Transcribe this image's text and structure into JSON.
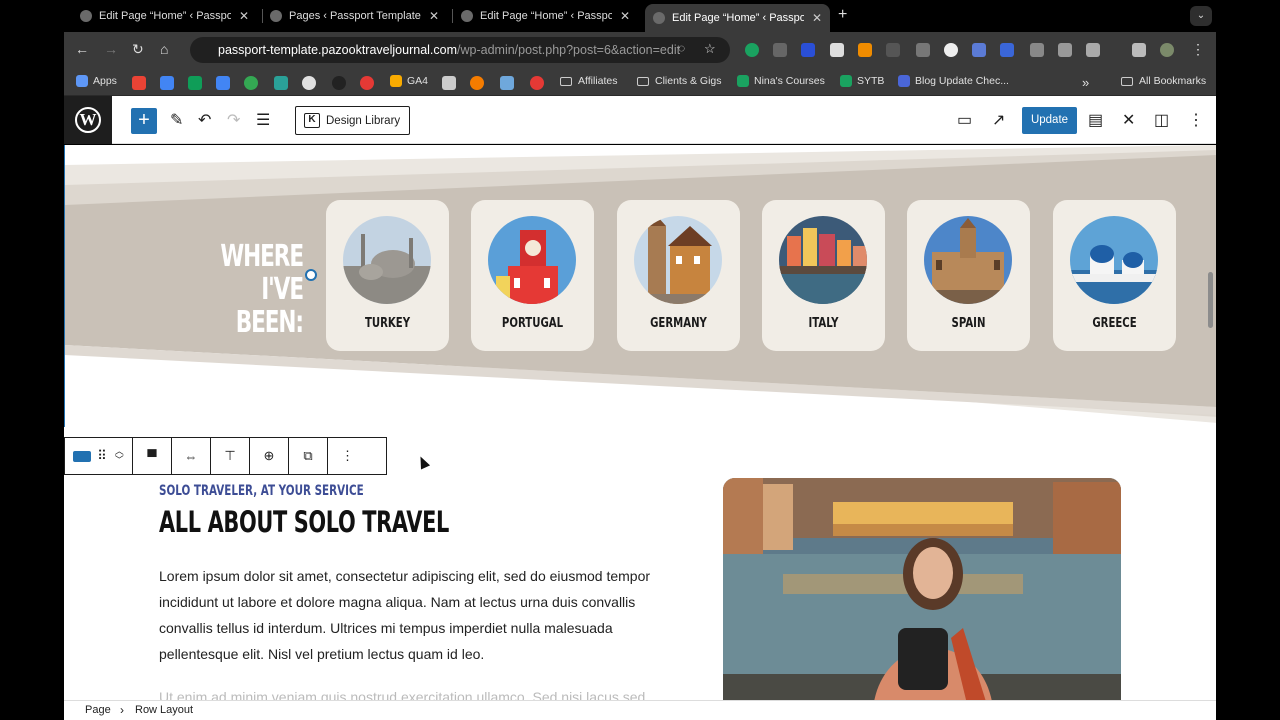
{
  "browser": {
    "tabs": [
      {
        "title": "Edit Page “Home” ‹ Passport",
        "active": false
      },
      {
        "title": "Pages ‹ Passport Template —",
        "active": false
      },
      {
        "title": "Edit Page “Home” ‹ Passport",
        "active": false
      },
      {
        "title": "Edit Page “Home” ‹ Passport",
        "active": true
      }
    ],
    "url_host": "passport-template.pazooktraveljournal.com",
    "url_path": "/wp-admin/post.php?post=6&action=edit",
    "bookmarks": [
      "Apps",
      "GA4",
      "Affiliates",
      "Clients & Gigs",
      "Nina's Courses",
      "SYTB",
      "Blog Update Chec...",
      "All Bookmarks"
    ]
  },
  "wp_toolbar": {
    "design_library": "Design Library",
    "update": "Update"
  },
  "hero": {
    "heading_line1": "WHERE I'VE",
    "heading_line2": "BEEN:",
    "countries": [
      "TURKEY",
      "PORTUGAL",
      "GERMANY",
      "ITALY",
      "SPAIN",
      "GREECE"
    ]
  },
  "about": {
    "kicker": "SOLO TRAVELER, AT YOUR SERVICE",
    "title": "ALL ABOUT SOLO TRAVEL",
    "paragraph": "Lorem ipsum dolor sit amet, consectetur adipiscing elit, sed do eiusmod tempor incididunt ut labore et dolore magna aliqua. Nam at lectus urna duis convallis convallis tellus id interdum. Ultrices mi tempus imperdiet nulla malesuada pellentesque elit. Nisl vel pretium lectus quam id leo.",
    "paragraph2": "Ut enim ad minim veniam quis nostrud exercitation ullamco. Sed nisi lacus sed viverra tellus in hac"
  },
  "breadcrumb": {
    "root": "Page",
    "current": "Row Layout"
  },
  "colors": {
    "accent": "#2271b1",
    "band": "#c9c1b7",
    "card": "#f1ede6",
    "kicker": "#3d4d95"
  }
}
